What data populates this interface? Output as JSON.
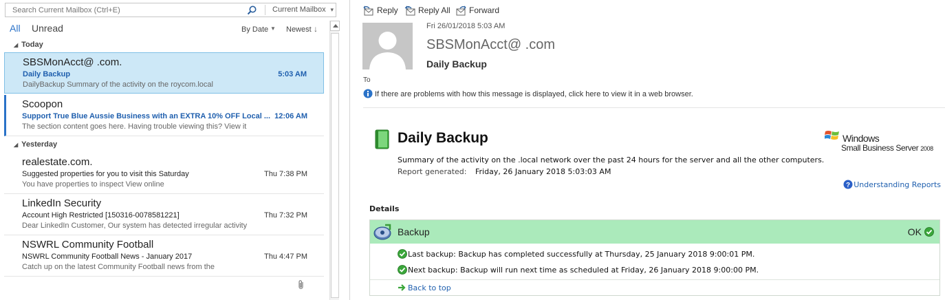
{
  "search": {
    "placeholder": "Search Current Mailbox (Ctrl+E)",
    "scope": "Current Mailbox"
  },
  "filters": {
    "all": "All",
    "unread": "Unread",
    "sort_by": "By Date",
    "sort_order": "Newest"
  },
  "groups": {
    "today": "Today",
    "yesterday": "Yesterday"
  },
  "mail_items": [
    {
      "sender": "SBSMonAcct@            .com.",
      "subject": "Daily Backup",
      "preview": "DailyBackup  Summary of the activity on the roycom.local",
      "time": "5:03 AM",
      "unread": true,
      "selected": true
    },
    {
      "sender": "Scoopon",
      "subject": "Support True Blue Aussie Business with an EXTRA 10% OFF Local ...",
      "preview": "The section content goes here.  Having trouble viewing this? View it",
      "time": "12:06 AM",
      "unread": true,
      "selected": false
    },
    {
      "sender": "realestate.com.",
      "subject": "Suggested properties for you to visit this Saturday",
      "preview": "You have properties to inspect  View online",
      "time": "Thu 7:38 PM",
      "unread": false,
      "selected": false
    },
    {
      "sender": "LinkedIn Security",
      "subject": "Account High Restricted [150316-0078581221]",
      "preview": "Dear LinkedIn Customer,  Our system has detected irregular activity",
      "time": "Thu 7:32 PM",
      "unread": false,
      "selected": false
    },
    {
      "sender": "NSWRL Community Football",
      "subject": "NSWRL Community Football News - January 2017",
      "preview": "Catch up on the latest Community Football news from the",
      "time": "Thu 4:47 PM",
      "unread": false,
      "selected": false
    }
  ],
  "toolbar": {
    "reply": "Reply",
    "reply_all": "Reply All",
    "forward": "Forward"
  },
  "message": {
    "date": "Fri 26/01/2018 5:03 AM",
    "from": "SBSMonAcct@            .com",
    "subject": "Daily Backup",
    "to_label": "To",
    "info_bar": "If there are problems with how this message is displayed, click here to view it in a web browser."
  },
  "report": {
    "title": "Daily Backup",
    "windows_name": "Windows",
    "windows_product": "Small Business Server ",
    "windows_year": "2008",
    "summary": "Summary of the activity on the             .local network over the past 24 hours for the server and all the other computers.",
    "generated_label": "Report generated:",
    "generated_value": "Friday, 26 January 2018 5:03:03 AM",
    "understanding_link": "Understanding Reports",
    "details_label": "Details",
    "backup": {
      "title": "Backup",
      "status": "OK",
      "last": "Last backup: Backup has completed successfully at Thursday, 25 January 2018 9:00:01 PM.",
      "next": "Next backup: Backup will run next time as scheduled at Friday, 26 January 2018 9:00:00 PM.",
      "back_to_top": "Back to top"
    }
  },
  "colors": {
    "accent_blue": "#2a72c8",
    "selected_bg": "#cde8f7",
    "backup_header_bg": "#abeabb",
    "ok_green": "#3aa63a"
  },
  "icons": [
    "search-icon",
    "chevron-down-icon",
    "reply-icon",
    "reply-all-icon",
    "forward-icon",
    "info-icon",
    "book-icon",
    "windows-logo",
    "help-icon",
    "backup-icon",
    "check-icon",
    "arrow-right-icon",
    "paperclip-icon"
  ]
}
